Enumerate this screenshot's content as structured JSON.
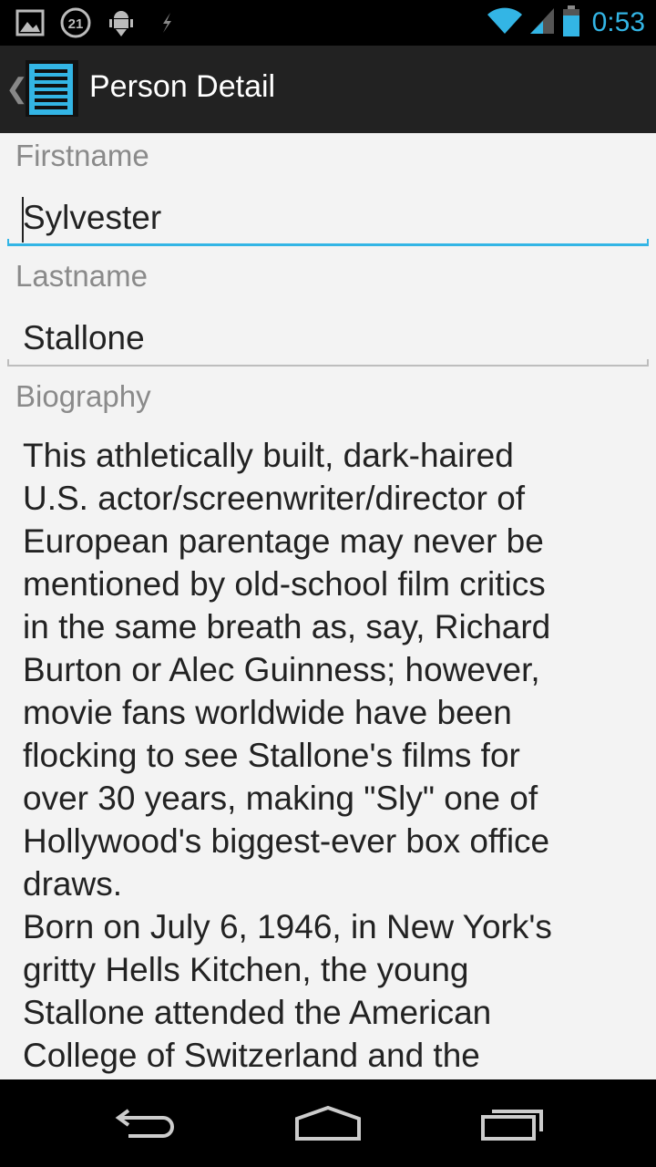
{
  "status_bar": {
    "time": "0:53",
    "notification_badge": "21",
    "icons": [
      "gallery-icon",
      "notification-count-icon",
      "android-debug-icon",
      "usb-icon",
      "wifi-icon",
      "cell-signal-icon",
      "battery-icon"
    ],
    "accent_color": "#33b5e5"
  },
  "action_bar": {
    "up_caret": "❮",
    "title": "Person Detail",
    "icon": "document-list-icon"
  },
  "form": {
    "firstname_label": "Firstname",
    "firstname_value": "Sylvester",
    "lastname_label": "Lastname",
    "lastname_value": "Stallone",
    "biography_label": "Biography",
    "biography_value": "This athletically built, dark-haired\nU.S. actor/screenwriter/director of\nEuropean parentage may never be\nmentioned by old-school film critics\nin the same breath as, say, Richard\nBurton or Alec Guinness; however,\nmovie fans worldwide have been\nflocking to see Stallone's films for\nover 30 years, making \"Sly\" one of\nHollywood's biggest-ever box office\ndraws.\nBorn on July 6, 1946, in New York's\ngritty Hells Kitchen, the young\nStallone attended the American\nCollege of Switzerland and the"
  },
  "nav_bar": {
    "buttons": [
      "back-icon",
      "home-icon",
      "recent-apps-icon"
    ]
  }
}
